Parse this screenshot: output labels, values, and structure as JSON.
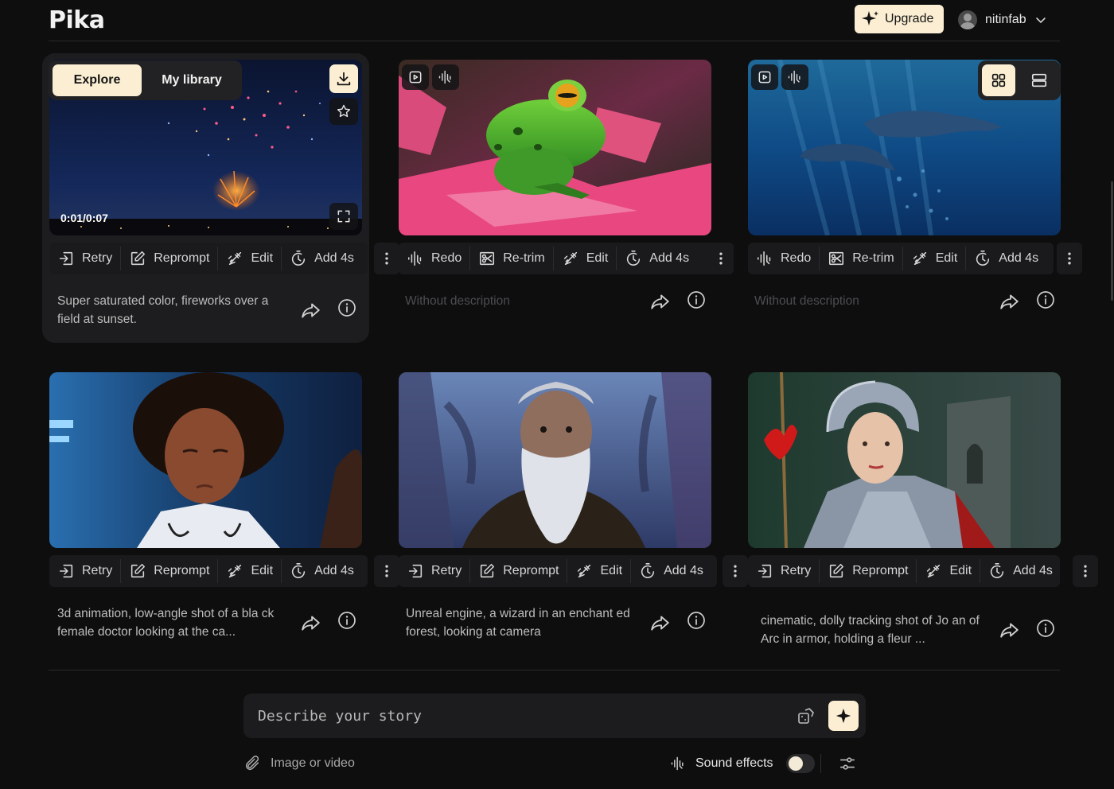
{
  "app": {
    "logo": "Pika"
  },
  "header": {
    "upgrade_label": "Upgrade",
    "username": "nitinfab"
  },
  "tabs": [
    {
      "label": "Explore",
      "active": true
    },
    {
      "label": "My library",
      "active": false
    }
  ],
  "view_toggle": {
    "active": "grid"
  },
  "video_cards": [
    {
      "thumbnail": "fireworks over a field at sunset",
      "timestamp": "0:01/0:07",
      "actions": [
        "Retry",
        "Reprompt",
        "Edit",
        "Add 4s"
      ],
      "description": "Super saturated color, fireworks over a field at sunset."
    },
    {
      "thumbnail": "green frog on pink lotus",
      "actions": [
        "Redo",
        "Re-trim",
        "Edit",
        "Add 4s"
      ],
      "description": "Without description"
    },
    {
      "thumbnail": "dolphins swimming underwater",
      "actions": [
        "Redo",
        "Re-trim",
        "Edit",
        "Add 4s"
      ],
      "description": "Without description"
    },
    {
      "thumbnail": "3d animated female doctor",
      "actions": [
        "Retry",
        "Reprompt",
        "Edit",
        "Add 4s"
      ],
      "description": "3d animation, low-angle shot of a bla ck female doctor looking at the ca..."
    },
    {
      "thumbnail": "bearded wizard in forest",
      "actions": [
        "Retry",
        "Reprompt",
        "Edit",
        "Add 4s"
      ],
      "description": "Unreal engine, a wizard in an enchant ed forest, looking at camera"
    },
    {
      "thumbnail": "Joan of Arc in armor",
      "actions": [
        "Retry",
        "Reprompt",
        "Edit",
        "Add 4s"
      ],
      "description": "cinematic, dolly tracking shot of Jo an of Arc in armor, holding a fleur ..."
    }
  ],
  "prompt": {
    "placeholder": "Describe your story"
  },
  "bottom_bar": {
    "attach_label": "Image or video",
    "sound_label": "Sound effects",
    "sound_enabled": false
  },
  "colors": {
    "background": "#0e0e0f",
    "accent": "#fbeed3",
    "card": "#1d1d1f"
  },
  "icons": [
    "sparkle-icon",
    "chevron-down-icon",
    "download-icon",
    "star-icon",
    "fullscreen-icon",
    "play-icon",
    "waveform-icon",
    "grid-view-icon",
    "list-view-icon",
    "retry-icon",
    "reprompt-icon",
    "edit-icon",
    "add-time-icon",
    "redo-icon",
    "retrim-icon",
    "more-icon",
    "share-icon",
    "info-icon",
    "dice-icon",
    "paperclip-icon",
    "settings-sliders-icon"
  ]
}
